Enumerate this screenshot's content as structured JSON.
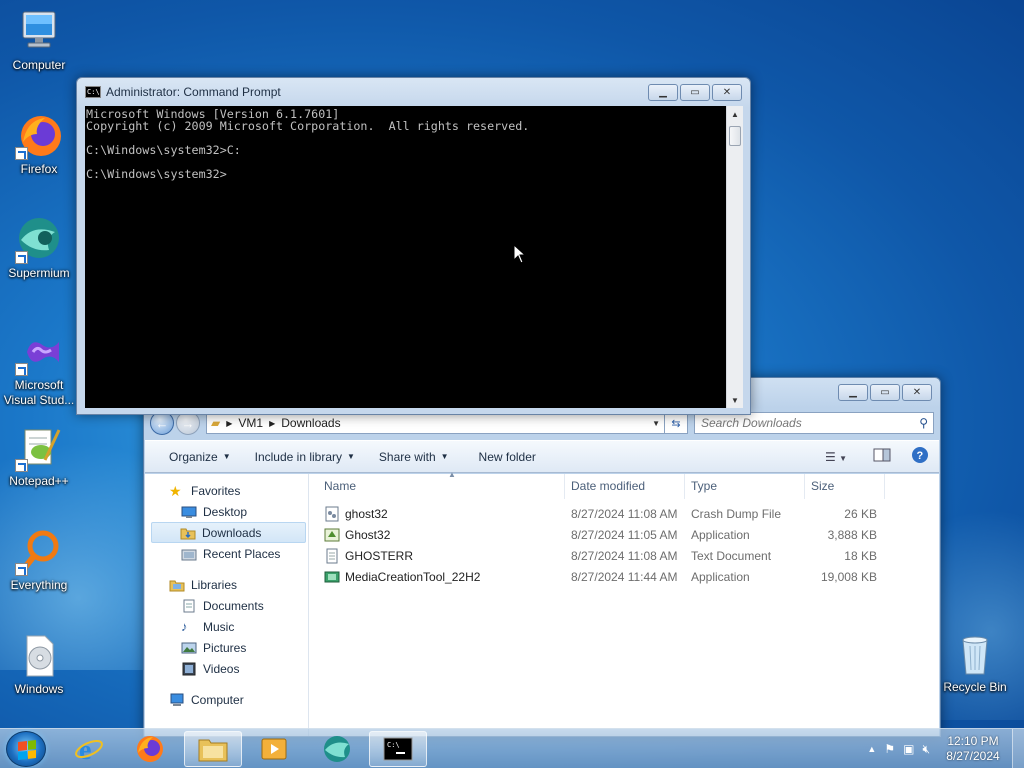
{
  "desktop": {
    "icons": [
      {
        "label": "Computer",
        "icon": "computer-icon"
      },
      {
        "label": "Firefox",
        "icon": "firefox-icon"
      },
      {
        "label": "Supermium",
        "icon": "supermium-icon"
      },
      {
        "label": "Microsoft Visual Stud...",
        "icon": "visual-studio-icon"
      },
      {
        "label": "Notepad++",
        "icon": "notepad-plus-plus-icon"
      },
      {
        "label": "Everything",
        "icon": "everything-search-icon"
      },
      {
        "label": "Windows",
        "icon": "disc-image-icon"
      },
      {
        "label": "Recycle Bin",
        "icon": "recycle-bin-icon"
      }
    ]
  },
  "cmd": {
    "title": "Administrator: Command Prompt",
    "lines": [
      "Microsoft Windows [Version 6.1.7601]",
      "Copyright (c) 2009 Microsoft Corporation.  All rights reserved.",
      "",
      "C:\\Windows\\system32>C:",
      "",
      "C:\\Windows\\system32>"
    ]
  },
  "explorer": {
    "breadcrumb": [
      "VM1",
      "Downloads"
    ],
    "search_placeholder": "Search Downloads",
    "toolbar": {
      "organize": "Organize",
      "include_in_library": "Include in library",
      "share_with": "Share with",
      "new_folder": "New folder"
    },
    "nav": {
      "favorites": "Favorites",
      "favorites_items": [
        "Desktop",
        "Downloads",
        "Recent Places"
      ],
      "libraries": "Libraries",
      "libraries_items": [
        "Documents",
        "Music",
        "Pictures",
        "Videos"
      ],
      "computer": "Computer"
    },
    "columns": {
      "name": "Name",
      "date": "Date modified",
      "type": "Type",
      "size": "Size"
    },
    "files": [
      {
        "name": "ghost32",
        "date": "8/27/2024 11:08 AM",
        "type": "Crash Dump File",
        "size": "26 KB",
        "icon": "dump-file-icon"
      },
      {
        "name": "Ghost32",
        "date": "8/27/2024 11:05 AM",
        "type": "Application",
        "size": "3,888 KB",
        "icon": "application-icon"
      },
      {
        "name": "GHOSTERR",
        "date": "8/27/2024 11:08 AM",
        "type": "Text Document",
        "size": "18 KB",
        "icon": "text-file-icon"
      },
      {
        "name": "MediaCreationTool_22H2",
        "date": "8/27/2024 11:44 AM",
        "type": "Application",
        "size": "19,008 KB",
        "icon": "media-creation-tool-icon"
      }
    ]
  },
  "taskbar": {
    "time": "12:10 PM",
    "date": "8/27/2024"
  }
}
